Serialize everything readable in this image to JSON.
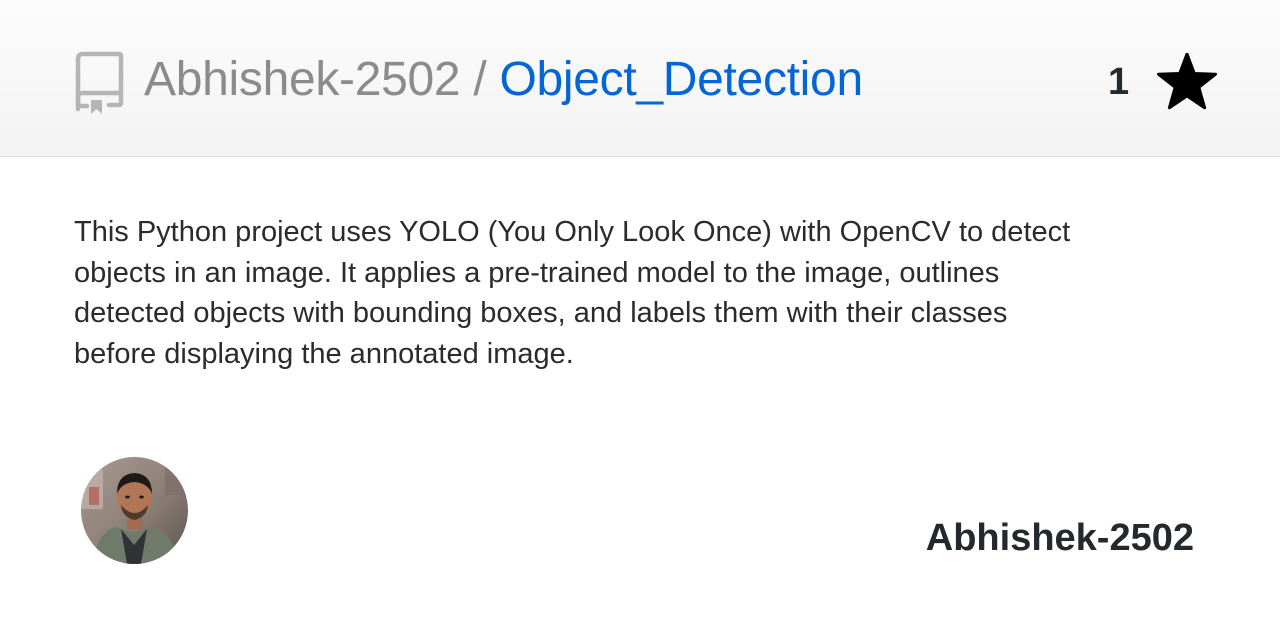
{
  "header": {
    "icon": "repo-icon",
    "owner": "Abhishek-2502",
    "separator": " / ",
    "repo_name": "Object_Detection",
    "star_count": "1",
    "star_icon": "star-icon"
  },
  "description": "This Python project uses YOLO (You Only Look Once) with OpenCV to detect objects in an image. It applies a pre-trained model to the image, outlines detected objects with bounding boxes, and labels them with their classes before displaying the annotated image.",
  "footer": {
    "avatar": "user-avatar",
    "author": "Abhishek-2502"
  },
  "colors": {
    "link": "#0366d6",
    "muted": "#8b8b8b",
    "text": "#24292e"
  }
}
